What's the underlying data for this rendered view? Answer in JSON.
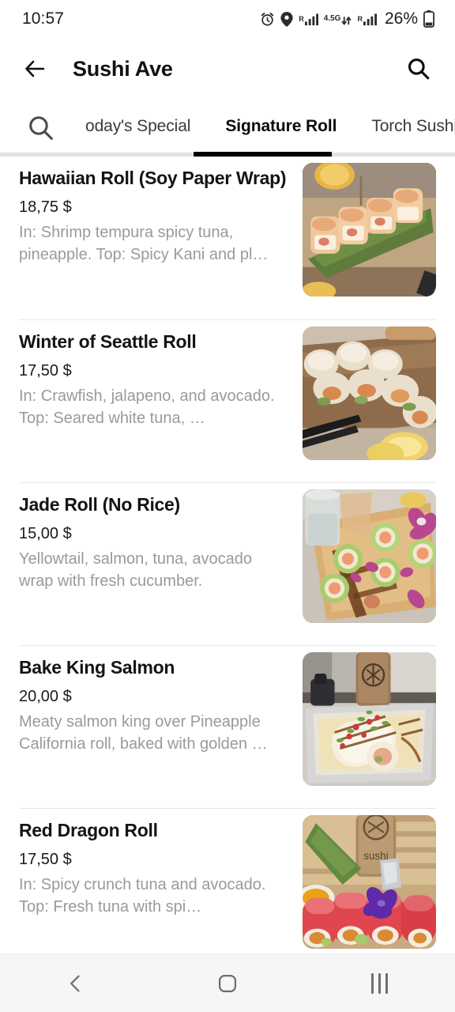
{
  "status_bar": {
    "time": "10:57",
    "battery_percent": "26%",
    "icons": [
      "alarm-icon",
      "location-pin-icon",
      "signal-roaming-icon",
      "network-4.5g-icon",
      "signal-roaming-2-icon",
      "battery-icon"
    ],
    "network_label": "4.5G",
    "roaming_label": "R"
  },
  "header": {
    "title": "Sushi Ave",
    "back_icon": "arrow-left-icon",
    "search_icon": "search-icon"
  },
  "tabs": {
    "search_icon": "search-icon",
    "items": [
      {
        "label": "oday's Special",
        "active": false
      },
      {
        "label": "Signature Roll",
        "active": true
      },
      {
        "label": "Torch Sushi",
        "active": false
      }
    ]
  },
  "menu": {
    "items": [
      {
        "name": "Hawaiian Roll (Soy Paper Wrap)",
        "price": "18,75 $",
        "description": "In: Shrimp tempura spicy tuna, pineapple. Top: Spicy Kani and pl…",
        "image_alt": "baked-hawaiian-roll-photo"
      },
      {
        "name": "Winter of Seattle Roll",
        "price": "17,50 $",
        "description": "In: Crawfish, jalapeno, and avocado. Top: Seared white tuna, …",
        "image_alt": "winter-of-seattle-roll-photo"
      },
      {
        "name": "Jade Roll (No Rice)",
        "price": "15,00 $",
        "description": "Yellowtail, salmon, tuna, avocado wrap with fresh cucumber.",
        "image_alt": "jade-roll-photo"
      },
      {
        "name": "Bake King Salmon",
        "price": "20,00 $",
        "description": "Meaty salmon king over Pineapple California roll, baked with golden …",
        "image_alt": "bake-king-salmon-photo"
      },
      {
        "name": "Red Dragon Roll",
        "price": "17,50 $",
        "description": "In: Spicy crunch tuna and avocado. Top: Fresh tuna with spi…",
        "image_alt": "red-dragon-roll-photo"
      }
    ]
  },
  "nav_bar": {
    "back_icon": "nav-back-icon",
    "home_icon": "nav-home-icon",
    "recents_icon": "nav-recents-icon"
  },
  "colors": {
    "accent": "#000000",
    "title_text": "#111111",
    "description_text": "#9a9a9a",
    "divider": "#e8e8e8",
    "nav_background": "#f6f6f6"
  }
}
